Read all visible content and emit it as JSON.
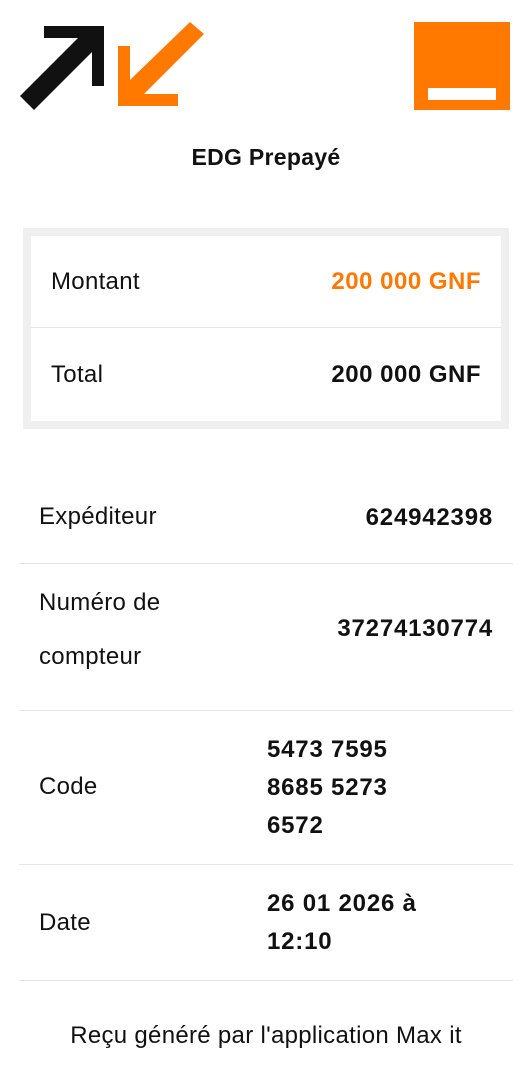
{
  "header": {
    "app_logo_icon": "max-it-arrows-logo",
    "brand_logo_icon": "orange-square-logo",
    "colors": {
      "brand": "#ff7900",
      "logo_dark": "#111111"
    }
  },
  "title": "EDG Prepayé",
  "summary": {
    "rows": [
      {
        "label": "Montant",
        "value": "200 000 GNF"
      },
      {
        "label": "Total",
        "value": "200 000 GNF"
      }
    ]
  },
  "details": {
    "sender": {
      "label": "Expéditeur",
      "value": "624942398"
    },
    "meter": {
      "label": "Numéro de compteur",
      "value": "37274130774"
    },
    "code": {
      "label": "Code",
      "value": "5473 7595 8685 5273 6572"
    },
    "date": {
      "label": "Date",
      "value": "26 01 2026 à 12:10"
    }
  },
  "footer": {
    "text": "Reçu généré par l'application Max it"
  }
}
